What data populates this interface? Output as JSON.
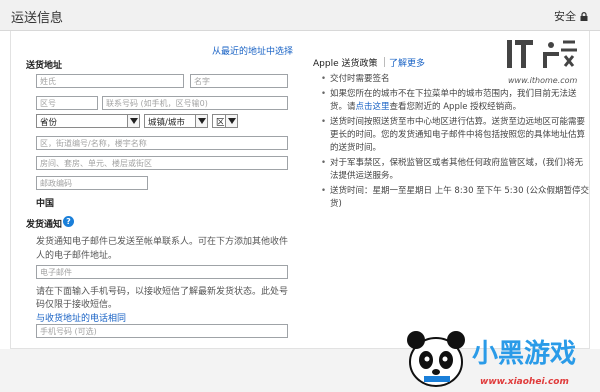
{
  "header": {
    "title": "运送信息",
    "secure_label": "安全"
  },
  "left": {
    "recent_address_link": "从最近的地址中选择",
    "address_label": "送货地址",
    "fields": {
      "last_name": "姓氏",
      "first_name": "名字",
      "area_code": "区号",
      "phone": "联系号码 (如手机，区号输0)",
      "street": "区，街道编号/名称，楼宇名称",
      "building": "房间、套房、单元、楼层或街区",
      "postal": "邮政编码"
    },
    "selects": {
      "province": "省份",
      "city": "城镇/城市",
      "district": "区"
    },
    "country": "中国",
    "notify_label": "发货通知",
    "notify_desc_line1": "发货通知电子邮件已发送至帐单联系人。可在下方添加其他收件",
    "notify_desc_line2": "人的电子邮件地址。",
    "email_placeholder": "电子邮件",
    "sms_desc_line1": "请在下面输入手机号码，以接收短信了解最新发货状态。此处号",
    "sms_desc_line2": "码仅限于接收短信。",
    "same_phone_link": "与收货地址的电话相同",
    "mobile_placeholder": "手机号码 (可选)"
  },
  "right": {
    "policy_title": "Apple 送货政策",
    "learn_more": "了解更多",
    "bullets": [
      {
        "pre": "交付时需要签名",
        "link": "",
        "post": ""
      },
      {
        "pre": "如果您所在的城市不在下拉菜单中的城市范围内，我们目前无法送货。请",
        "link": "点击这里",
        "post": "查看您附近的 Apple 授权经销商。"
      },
      {
        "pre": "送货时间按照送货至市中心地区进行估算。送货至边远地区可能需要更长的时间。您的发货通知电子邮件中将包括按照您的具体地址估算的送货时间。",
        "link": "",
        "post": ""
      },
      {
        "pre": "对于军事禁区，保税监管区或者其他任何政府监管区域，(我们)将无法提供运送服务。",
        "link": "",
        "post": ""
      },
      {
        "pre": "送货时间：星期一至星期日 上午 8:30 至下午 5:30 (公众假期暂停交货)",
        "link": "",
        "post": ""
      }
    ]
  },
  "watermark": {
    "site": "www.ithome.com",
    "brand": "小黑游戏",
    "url": "www.xiaohei.com"
  },
  "colors": {
    "link": "#1a63c5",
    "help_icon": "#1a7fd9",
    "header_bg": "#f1f1f1"
  }
}
